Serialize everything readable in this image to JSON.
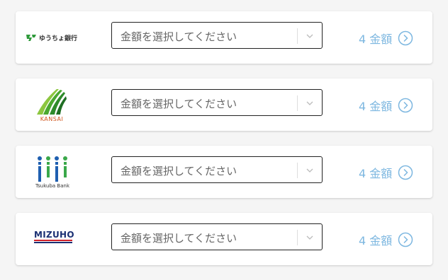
{
  "banks": [
    {
      "logo_text": "ゆうちょ銀行",
      "select_placeholder": "金額を選択してください",
      "count_label": "4 金額",
      "logo_icon": "japan-post-bank-logo"
    },
    {
      "logo_text": "KANSAI",
      "select_placeholder": "金額を選択してください",
      "count_label": "4 金額",
      "logo_icon": "kansai-bank-logo"
    },
    {
      "logo_text": "Tsukuba Bank",
      "select_placeholder": "金額を選択してください",
      "count_label": "4 金額",
      "logo_icon": "tsukuba-bank-logo"
    },
    {
      "logo_text": "MIZUHO",
      "select_placeholder": "金額を選択してください",
      "count_label": "4 金額",
      "logo_icon": "mizuho-bank-logo"
    }
  ],
  "colors": {
    "accent": "#7db7e0",
    "japan_post_green": "#2e9a3a",
    "kansai_green": "#4aa82f",
    "kansai_orange": "#d0541b",
    "tsukuba_blue": "#1f5fb0",
    "tsukuba_green": "#3aa84a",
    "mizuho_navy": "#1a2f73",
    "mizuho_red": "#d0202a"
  }
}
